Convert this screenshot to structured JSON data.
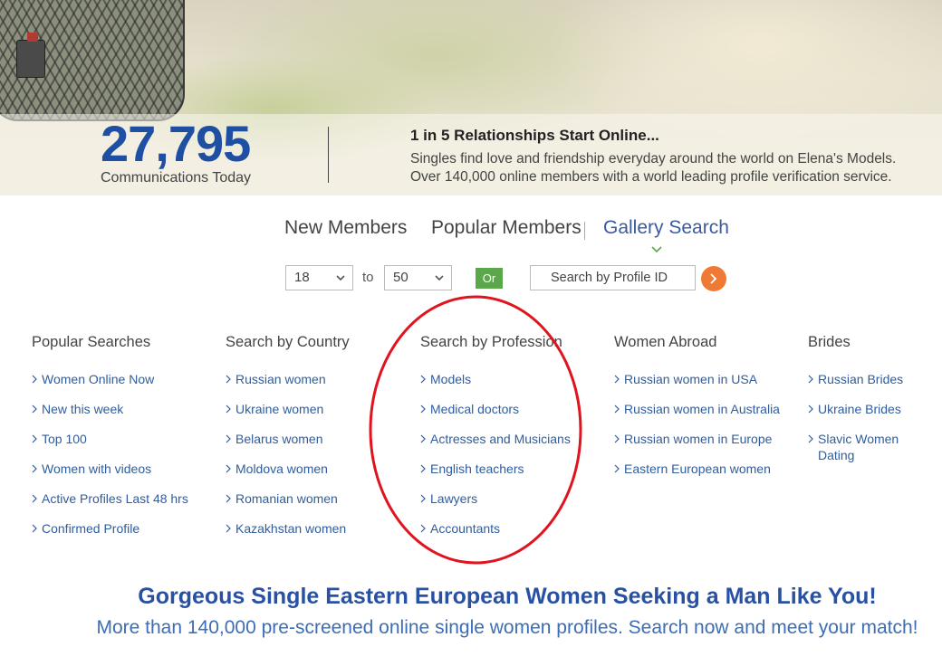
{
  "hero": {
    "count": "27,795",
    "count_label": "Communications Today",
    "title": "1 in 5 Relationships Start Online...",
    "description": "Singles find love and friendship everyday around the world on Elena's Models. Over 140,000 online members with a world leading profile verification service."
  },
  "tabs": [
    {
      "label": "New Members",
      "active": false
    },
    {
      "label": "Popular Members",
      "active": false
    },
    {
      "label": "Gallery Search",
      "active": true
    }
  ],
  "search": {
    "age_from": "18",
    "age_to": "50",
    "to_label": "to",
    "or_label": "Or",
    "profile_id_placeholder": "Search by Profile ID"
  },
  "columns": [
    {
      "title": "Popular Searches",
      "links": [
        "Women Online Now",
        "New this week",
        "Top 100",
        "Women with videos",
        "Active Profiles Last 48 hrs",
        "Confirmed Profile"
      ]
    },
    {
      "title": "Search by Country",
      "links": [
        "Russian women",
        "Ukraine women",
        "Belarus women",
        "Moldova women",
        "Romanian women",
        "Kazakhstan women"
      ]
    },
    {
      "title": "Search by Profession",
      "links": [
        "Models",
        "Medical doctors",
        "Actresses and Musicians",
        "English teachers",
        "Lawyers",
        "Accountants"
      ]
    },
    {
      "title": "Women Abroad",
      "links": [
        "Russian women in USA",
        "Russian women in Australia",
        "Russian women in Europe",
        "Eastern European women"
      ]
    },
    {
      "title": "Brides",
      "links": [
        "Russian Brides",
        "Ukraine Brides",
        "Slavic Women Dating"
      ]
    }
  ],
  "footer": {
    "headline": "Gorgeous Single Eastern European Women Seeking a Man Like You!",
    "subline": "More than 140,000 pre-screened online single women profiles. Search now and meet your match!"
  },
  "colors": {
    "primary_blue": "#1f4fa3",
    "link_blue": "#2f5d9e",
    "or_green": "#5aa84b",
    "go_orange": "#f07a35",
    "highlight_red": "#e0141e"
  },
  "icons": {
    "go": "chevron-right-icon",
    "select": "chevron-down-icon",
    "link_bullet": "chevron-right-icon"
  }
}
